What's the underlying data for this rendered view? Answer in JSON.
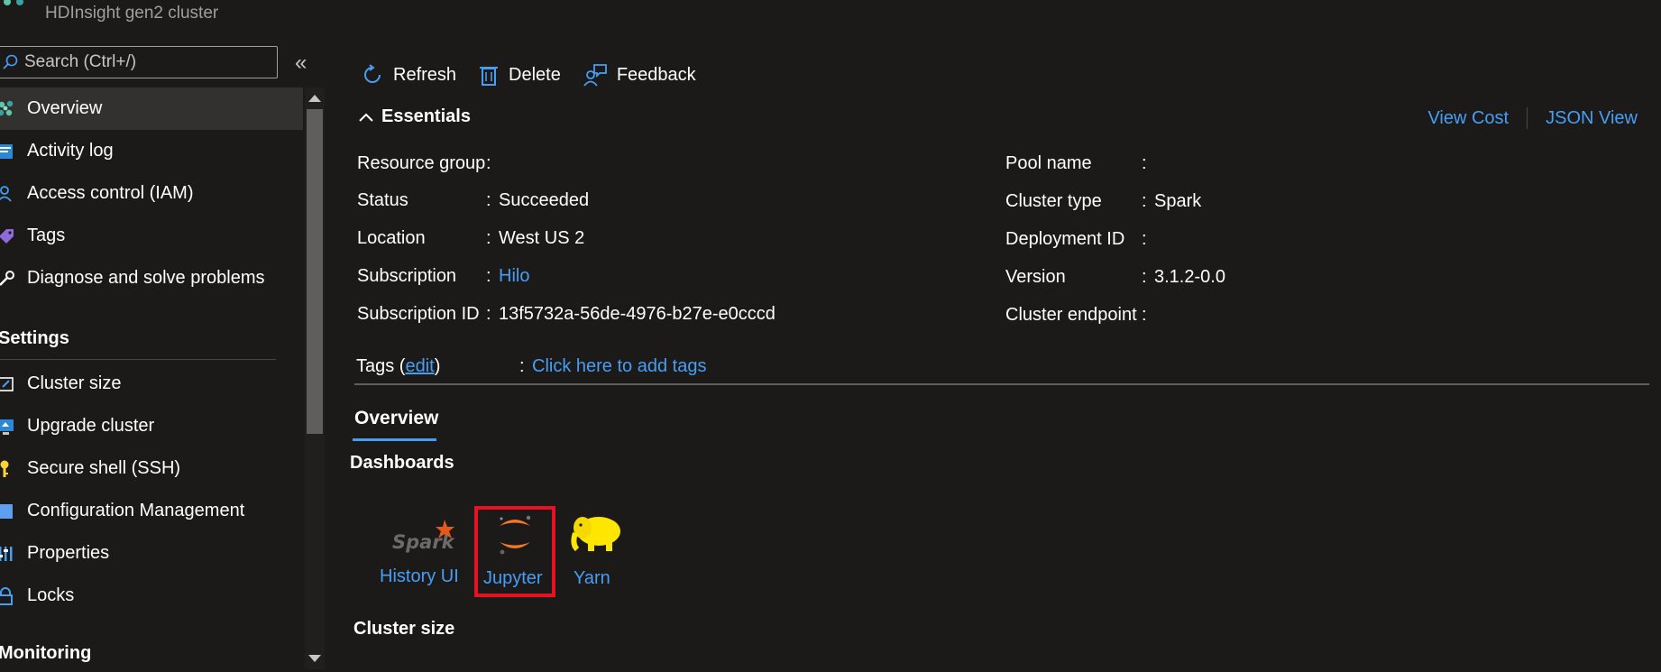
{
  "header": {
    "subtitle": "HDInsight gen2 cluster"
  },
  "sidebar": {
    "search_placeholder": "Search (Ctrl+/)",
    "collapse_glyph": "«",
    "items": [
      {
        "label": "Overview",
        "icon": "cluster-icon"
      },
      {
        "label": "Activity log",
        "icon": "activity-log-icon"
      },
      {
        "label": "Access control (IAM)",
        "icon": "people-icon"
      },
      {
        "label": "Tags",
        "icon": "tag-icon"
      },
      {
        "label": "Diagnose and solve problems",
        "icon": "wrench-icon"
      }
    ],
    "settings_heading": "Settings",
    "settings_items": [
      {
        "label": "Cluster size",
        "icon": "resize-icon"
      },
      {
        "label": "Upgrade cluster",
        "icon": "upgrade-icon"
      },
      {
        "label": "Secure shell (SSH)",
        "icon": "key-icon"
      },
      {
        "label": "Configuration Management",
        "icon": "config-icon"
      },
      {
        "label": "Properties",
        "icon": "properties-icon"
      },
      {
        "label": "Locks",
        "icon": "lock-icon"
      }
    ],
    "monitoring_heading": "Monitoring"
  },
  "toolbar": {
    "refresh": "Refresh",
    "delete": "Delete",
    "feedback": "Feedback"
  },
  "essentials": {
    "toggle_label": "Essentials",
    "view_cost": "View Cost",
    "json_view": "JSON View",
    "left": {
      "resource_group_label": "Resource group",
      "resource_group_value": "",
      "status_label": "Status",
      "status_value": "Succeeded",
      "location_label": "Location",
      "location_value": "West US 2",
      "subscription_label": "Subscription",
      "subscription_value": "Hilo",
      "subscription_id_label": "Subscription ID",
      "subscription_id_value": "13f5732a-56de-4976-b27e-e0cccd"
    },
    "right": {
      "pool_name_label": "Pool name",
      "pool_name_value": "",
      "cluster_type_label": "Cluster type",
      "cluster_type_value": "Spark",
      "deployment_id_label": "Deployment ID",
      "deployment_id_value": "",
      "version_label": "Version",
      "version_value": "3.1.2-0.0",
      "cluster_endpoint_label": "Cluster endpoint",
      "cluster_endpoint_value": ""
    },
    "tags_label_prefix": "Tags (",
    "tags_edit": "edit",
    "tags_label_suffix": ")",
    "tags_value": "Click here to add tags",
    "colon": ":"
  },
  "overview_tab": "Overview",
  "dashboards": {
    "heading": "Dashboards",
    "items": [
      {
        "label": "History UI",
        "icon": "spark-icon"
      },
      {
        "label": "Jupyter",
        "icon": "jupyter-icon"
      },
      {
        "label": "Yarn",
        "icon": "hadoop-elephant-icon"
      }
    ]
  },
  "cluster_size_heading": "Cluster size",
  "colors": {
    "background": "#1b1a19",
    "link": "#479ef5",
    "highlight": "#e81123",
    "active_nav": "#323130"
  }
}
